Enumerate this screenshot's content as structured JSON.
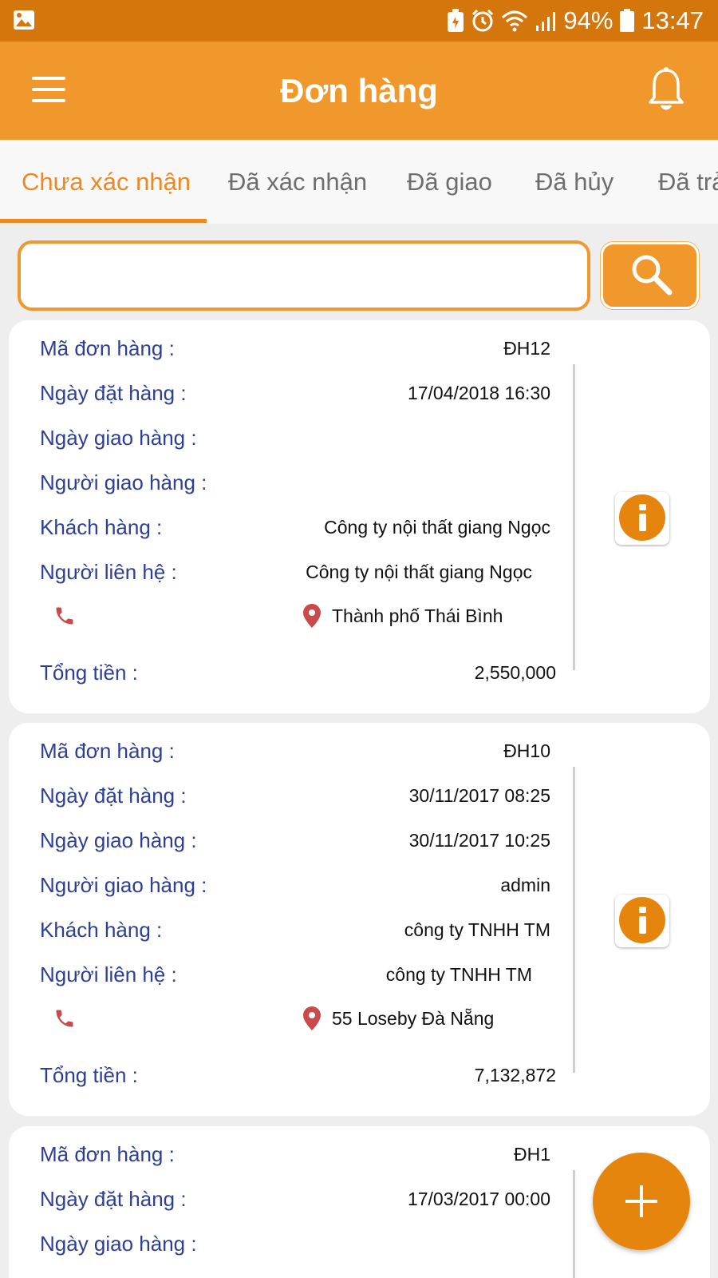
{
  "status_bar": {
    "battery": "94%",
    "time": "13:47",
    "icons": [
      "gallery-icon",
      "battery-saver-icon",
      "alarm-icon",
      "wifi-icon",
      "signal-icon",
      "battery-icon"
    ]
  },
  "app_bar": {
    "title": "Đơn hàng",
    "icons": [
      "menu-icon",
      "bell-icon"
    ]
  },
  "tabs": [
    {
      "label": "Chưa xác nhận",
      "active": true
    },
    {
      "label": "Đã xác nhận",
      "active": false
    },
    {
      "label": "Đã giao",
      "active": false
    },
    {
      "label": "Đã hủy",
      "active": false
    },
    {
      "label": "Đã trả",
      "active": false
    }
  ],
  "search": {
    "value": "",
    "placeholder": ""
  },
  "field_labels": {
    "order_code": "Mã đơn hàng :",
    "order_date": "Ngày đặt hàng :",
    "delivery_date": "Ngày giao hàng :",
    "shipper": "Người giao hàng :",
    "customer": "Khách hàng :",
    "contact": "Người liên hệ :",
    "total": "Tổng tiền :"
  },
  "orders": [
    {
      "code": "ĐH12",
      "order_date": "17/04/2018 16:30",
      "delivery_date": "",
      "shipper": "",
      "customer": "Công ty nội thất giang Ngọc",
      "contact": "Công ty nội thất giang Ngọc",
      "address": "Thành phố Thái Bình",
      "total": "2,550,000"
    },
    {
      "code": "ĐH10",
      "order_date": "30/11/2017 08:25",
      "delivery_date": "30/11/2017 10:25",
      "shipper": "admin",
      "customer": "công ty TNHH TM",
      "contact": "công ty TNHH TM",
      "address": "55 Loseby Đà Nẵng",
      "total": "7,132,872"
    },
    {
      "code": "ĐH1",
      "order_date": "17/03/2017 00:00",
      "delivery_date": ""
    }
  ],
  "colors": {
    "status_bar": "#d4760b",
    "primary": "#f0982b",
    "accent": "#ea8a22",
    "label_text": "#2d3f92",
    "icon_red": "#c94a4a"
  }
}
